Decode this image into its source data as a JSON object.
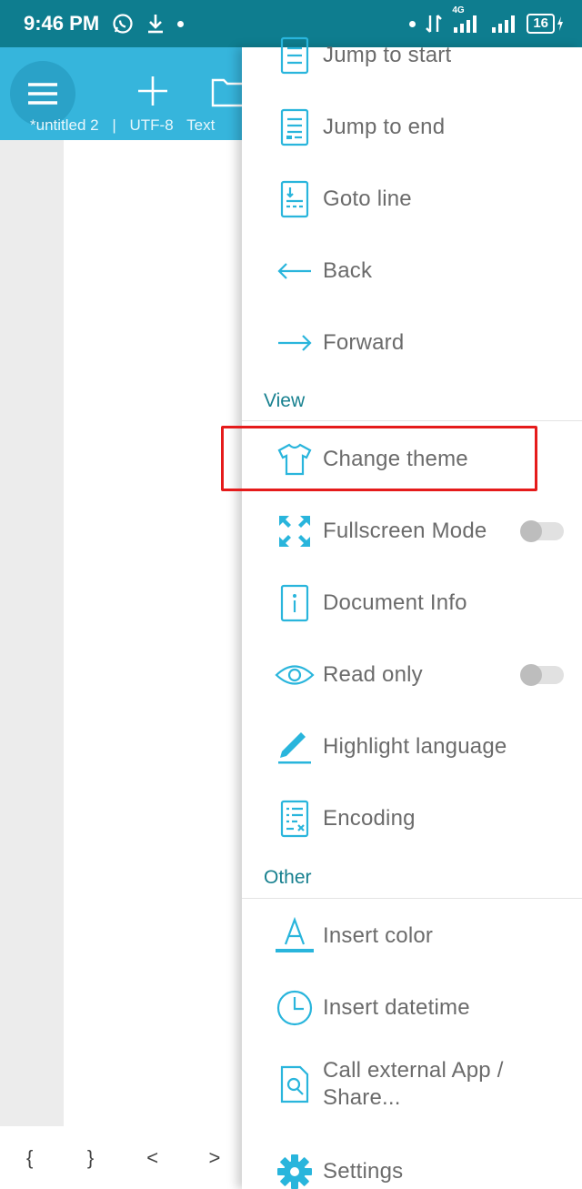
{
  "status_bar": {
    "time": "9:46 PM",
    "network_label": "4G",
    "battery": "16"
  },
  "app_bar": {
    "document_name": "*untitled 2",
    "separator": "|",
    "encoding": "UTF-8",
    "mode": "Text"
  },
  "symbol_bar": {
    "keys": [
      "{",
      "}",
      "<",
      ">"
    ]
  },
  "drawer": {
    "items_top": [
      {
        "label": "Jump to start",
        "icon": "jump-start-icon"
      },
      {
        "label": "Jump to end",
        "icon": "jump-end-icon"
      },
      {
        "label": "Goto line",
        "icon": "goto-line-icon"
      },
      {
        "label": "Back",
        "icon": "arrow-left-icon"
      },
      {
        "label": "Forward",
        "icon": "arrow-right-icon"
      }
    ],
    "view_section": {
      "title": "View",
      "items": [
        {
          "label": "Change theme",
          "icon": "tshirt-icon"
        },
        {
          "label": "Fullscreen Mode",
          "icon": "fullscreen-icon",
          "toggle": false
        },
        {
          "label": "Document Info",
          "icon": "info-icon"
        },
        {
          "label": "Read only",
          "icon": "eye-icon",
          "toggle": false
        },
        {
          "label": "Highlight language",
          "icon": "pencil-icon"
        },
        {
          "label": "Encoding",
          "icon": "encoding-icon"
        }
      ]
    },
    "other_section": {
      "title": "Other",
      "items": [
        {
          "label": "Insert color",
          "icon": "text-color-icon"
        },
        {
          "label": "Insert datetime",
          "icon": "clock-icon"
        },
        {
          "label": "Call external App / Share...",
          "icon": "external-app-icon"
        },
        {
          "label": "Settings",
          "icon": "gear-icon"
        }
      ]
    }
  },
  "colors": {
    "status_bar": "#0e7d8f",
    "app_bar": "#36b5dc",
    "accent_icon": "#29b5dc",
    "section_title": "#17808f",
    "highlight_box": "#e51b1b"
  }
}
